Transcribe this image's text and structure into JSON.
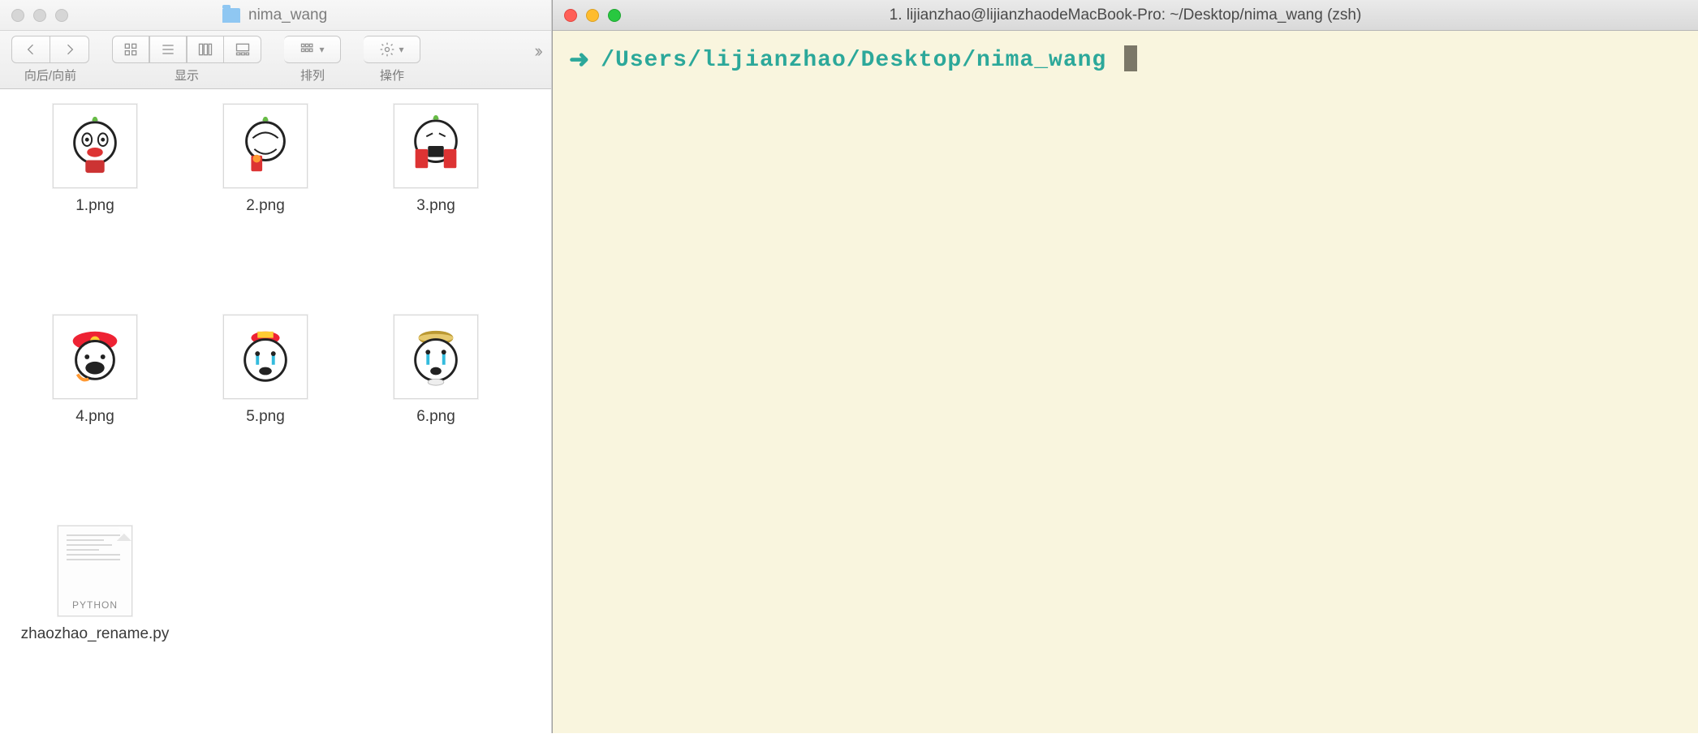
{
  "finder": {
    "window_title": "nima_wang",
    "toolbar": {
      "back_forward_label": "向后/向前",
      "view_label": "显示",
      "arrange_label": "排列",
      "action_label": "操作"
    },
    "files": [
      {
        "name": "1.png",
        "kind": "image"
      },
      {
        "name": "2.png",
        "kind": "image"
      },
      {
        "name": "3.png",
        "kind": "image"
      },
      {
        "name": "4.png",
        "kind": "image"
      },
      {
        "name": "5.png",
        "kind": "image"
      },
      {
        "name": "6.png",
        "kind": "image"
      },
      {
        "name": "zhaozhao_rename.py",
        "kind": "python"
      }
    ],
    "python_badge": "PYTHON"
  },
  "terminal": {
    "title": "1. lijianzhao@lijianzhaodeMacBook-Pro: ~/Desktop/nima_wang (zsh)",
    "prompt_symbol": "➜",
    "cwd": "/Users/lijianzhao/Desktop/nima_wang"
  }
}
